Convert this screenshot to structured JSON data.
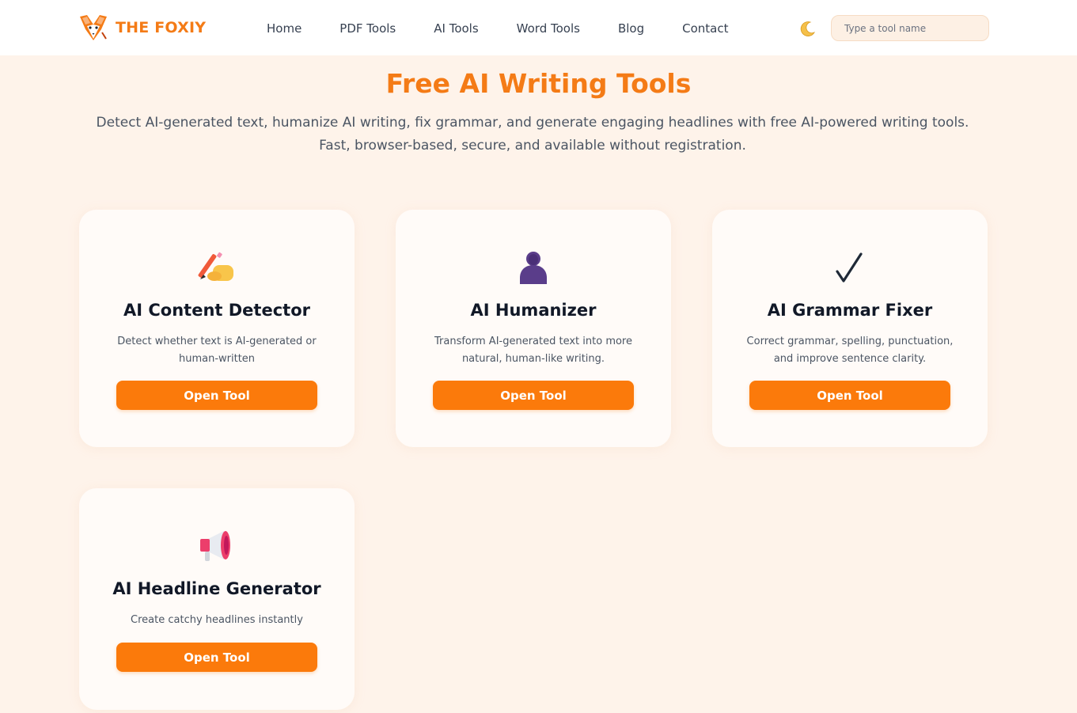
{
  "header": {
    "brand": "THE FOXIY",
    "nav": [
      "Home",
      "PDF Tools",
      "AI Tools",
      "Word Tools",
      "Blog",
      "Contact"
    ],
    "search_placeholder": "Type a tool name"
  },
  "hero": {
    "title": "Free AI Writing Tools",
    "subtitle": "Detect AI-generated text, humanize AI writing, fix grammar, and generate engaging headlines with free AI-powered writing tools. Fast, browser-based, secure, and available without registration."
  },
  "cards": [
    {
      "icon": "writing-hand-icon",
      "title": "AI Content Detector",
      "description": "Detect whether text is AI-generated or human-written",
      "button": "Open Tool"
    },
    {
      "icon": "person-silhouette-icon",
      "title": "AI Humanizer",
      "description": "Transform AI-generated text into more natural, human-like writing.",
      "button": "Open Tool"
    },
    {
      "icon": "checkmark-icon",
      "title": "AI Grammar Fixer",
      "description": "Correct grammar, spelling, punctuation, and improve sentence clarity.",
      "button": "Open Tool"
    },
    {
      "icon": "megaphone-icon",
      "title": "AI Headline Generator",
      "description": "Create catchy headlines instantly",
      "button": "Open Tool"
    }
  ],
  "colors": {
    "accent": "#f47b16",
    "button": "#fb7a0b",
    "page_background": "#fef3ea"
  }
}
